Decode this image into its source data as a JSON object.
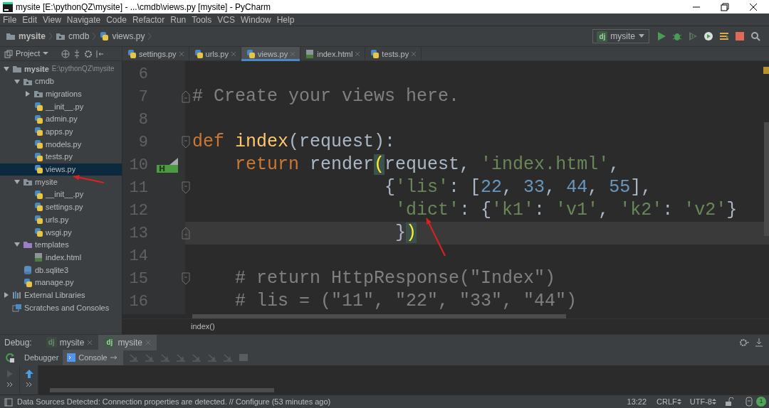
{
  "window": {
    "title": "mysite [E:\\pythonQZ\\mysite] - ...\\cmdb\\views.py [mysite] - PyCharm"
  },
  "menu": [
    "File",
    "Edit",
    "View",
    "Navigate",
    "Code",
    "Refactor",
    "Run",
    "Tools",
    "VCS",
    "Window",
    "Help"
  ],
  "breadcrumbs": [
    {
      "label": "mysite",
      "kind": "folder"
    },
    {
      "label": "cmdb",
      "kind": "package"
    },
    {
      "label": "views.py",
      "kind": "python"
    }
  ],
  "run_config": {
    "icon_text": "dj",
    "label": "mysite"
  },
  "project_panel": {
    "title": "Project"
  },
  "editor_tabs": [
    {
      "label": "settings.py",
      "kind": "python",
      "selected": false
    },
    {
      "label": "urls.py",
      "kind": "python",
      "selected": false
    },
    {
      "label": "views.py",
      "kind": "python",
      "selected": true
    },
    {
      "label": "index.html",
      "kind": "html",
      "selected": false
    },
    {
      "label": "tests.py",
      "kind": "python",
      "selected": false
    }
  ],
  "project_tree": [
    {
      "label": "mysite",
      "path": "E:\\pythonQZ\\mysite",
      "kind": "folder",
      "expanded": true,
      "selected": false,
      "children": [
        {
          "label": "cmdb",
          "kind": "package",
          "expanded": true,
          "selected": false,
          "children": [
            {
              "label": "migrations",
              "kind": "package",
              "expanded": false,
              "selected": false
            },
            {
              "label": "__init__.py",
              "kind": "python",
              "selected": false
            },
            {
              "label": "admin.py",
              "kind": "python",
              "selected": false
            },
            {
              "label": "apps.py",
              "kind": "python",
              "selected": false
            },
            {
              "label": "models.py",
              "kind": "python",
              "selected": false
            },
            {
              "label": "tests.py",
              "kind": "python",
              "selected": false
            },
            {
              "label": "views.py",
              "kind": "python",
              "selected": true
            }
          ]
        },
        {
          "label": "mysite",
          "kind": "package",
          "expanded": true,
          "selected": false,
          "children": [
            {
              "label": "__init__.py",
              "kind": "python",
              "selected": false
            },
            {
              "label": "settings.py",
              "kind": "python",
              "selected": false
            },
            {
              "label": "urls.py",
              "kind": "python",
              "selected": false
            },
            {
              "label": "wsgi.py",
              "kind": "python",
              "selected": false
            }
          ]
        },
        {
          "label": "templates",
          "kind": "templates",
          "expanded": true,
          "selected": false,
          "children": [
            {
              "label": "index.html",
              "kind": "html",
              "selected": false
            }
          ]
        },
        {
          "label": "db.sqlite3",
          "kind": "database",
          "selected": false
        },
        {
          "label": "manage.py",
          "kind": "python",
          "selected": false
        }
      ]
    },
    {
      "label": "External Libraries",
      "kind": "libraries",
      "expanded": false,
      "selected": false
    },
    {
      "label": "Scratches and Consoles",
      "kind": "scratches",
      "selected": false
    }
  ],
  "editor": {
    "lines": [
      {
        "number": "6",
        "current": false
      },
      {
        "number": "7",
        "current": false,
        "fold_end": true,
        "tokens": [
          {
            "kind": "comment",
            "text": "# Create your views here."
          }
        ]
      },
      {
        "number": "8",
        "current": false
      },
      {
        "number": "9",
        "current": false,
        "fold_start": true,
        "tokens": [
          {
            "kind": "keyword",
            "text": "def "
          },
          {
            "kind": "function",
            "text": "index"
          },
          {
            "kind": "plain",
            "text": "(request):"
          }
        ]
      },
      {
        "number": "10",
        "current": false,
        "marker": "H",
        "tokens": [
          {
            "kind": "keyword",
            "text": "    return"
          },
          {
            "kind": "plain",
            "text": " render"
          },
          {
            "kind": "match",
            "text": "("
          },
          {
            "kind": "plain",
            "text": "request, "
          },
          {
            "kind": "string",
            "text": "'index.html'"
          },
          {
            "kind": "plain",
            "text": ","
          }
        ]
      },
      {
        "number": "11",
        "current": false,
        "fold_start": true,
        "tokens": [
          {
            "kind": "plain",
            "text": "                  {"
          },
          {
            "kind": "string",
            "text": "'lis'"
          },
          {
            "kind": "plain",
            "text": ": ["
          },
          {
            "kind": "number",
            "text": "22"
          },
          {
            "kind": "plain",
            "text": ", "
          },
          {
            "kind": "number",
            "text": "33"
          },
          {
            "kind": "plain",
            "text": ", "
          },
          {
            "kind": "number",
            "text": "44"
          },
          {
            "kind": "plain",
            "text": ", "
          },
          {
            "kind": "number",
            "text": "55"
          },
          {
            "kind": "plain",
            "text": "],"
          }
        ]
      },
      {
        "number": "12",
        "current": false,
        "tokens": [
          {
            "kind": "string",
            "text": "                   'dict'"
          },
          {
            "kind": "plain",
            "text": ": {"
          },
          {
            "kind": "string",
            "text": "'k1'"
          },
          {
            "kind": "plain",
            "text": ": "
          },
          {
            "kind": "string",
            "text": "'v1'"
          },
          {
            "kind": "plain",
            "text": ", "
          },
          {
            "kind": "string",
            "text": "'k2'"
          },
          {
            "kind": "plain",
            "text": ": "
          },
          {
            "kind": "string",
            "text": "'v2'"
          },
          {
            "kind": "plain",
            "text": "}"
          }
        ]
      },
      {
        "number": "13",
        "current": true,
        "fold_end": true,
        "tokens": [
          {
            "kind": "plain",
            "text": "                   }"
          },
          {
            "kind": "match",
            "text": ")"
          }
        ]
      },
      {
        "number": "14",
        "current": false
      },
      {
        "number": "15",
        "current": false,
        "fold_start": true,
        "tokens": [
          {
            "kind": "comment",
            "text": "    # return HttpResponse(\"Index\")"
          }
        ]
      },
      {
        "number": "16",
        "current": false,
        "tokens": [
          {
            "kind": "comment",
            "text": "    # lis = (\"11\", \"22\", \"33\", \"44\")"
          }
        ]
      }
    ],
    "breadcrumb": "index()"
  },
  "debug": {
    "label": "Debug:",
    "tabs": [
      {
        "icon_text": "dj",
        "label": "mysite",
        "selected": false
      },
      {
        "icon_text": "dj",
        "label": "mysite",
        "selected": true
      }
    ],
    "subtabs": [
      {
        "label": "Debugger",
        "selected": false
      },
      {
        "label": "Console",
        "selected": true
      }
    ]
  },
  "status_bar": {
    "message": "Data Sources Detected: Connection properties are detected. // Configure (53 minutes ago)",
    "position": "13:22",
    "line_ending": "CRLF",
    "encoding": "UTF-8",
    "notifications": "1"
  }
}
